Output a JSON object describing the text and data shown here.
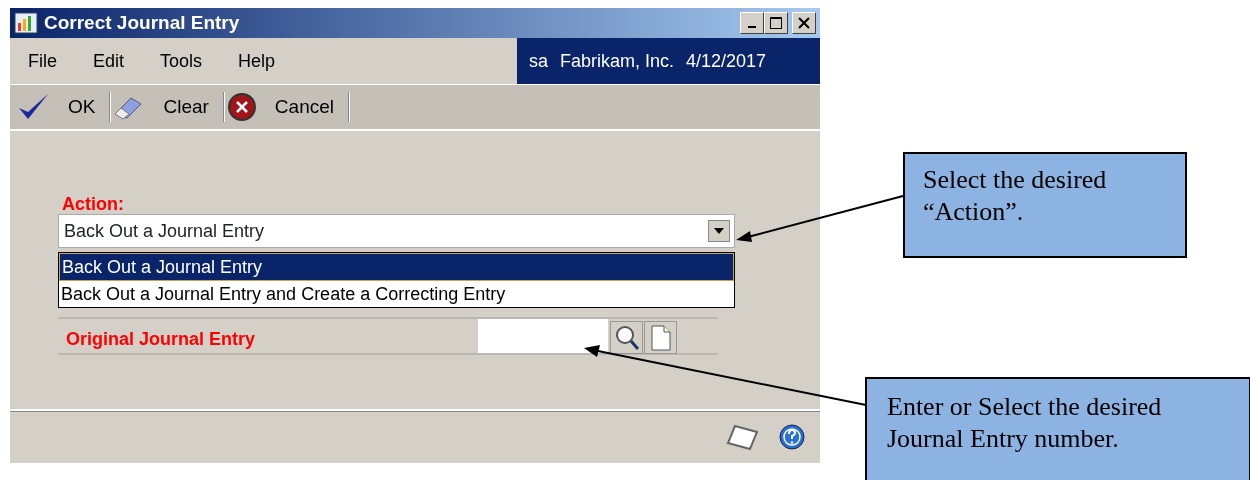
{
  "window": {
    "title": "Correct Journal Entry"
  },
  "menu": [
    {
      "label": "File"
    },
    {
      "label": "Edit"
    },
    {
      "label": "Tools"
    },
    {
      "label": "Help"
    }
  ],
  "session": {
    "user": "sa",
    "company": "Fabrikam, Inc.",
    "date": "4/12/2017"
  },
  "toolbar": [
    {
      "kind": "ok",
      "label": "OK"
    },
    {
      "kind": "clear",
      "label": "Clear"
    },
    {
      "kind": "cancel",
      "label": "Cancel"
    }
  ],
  "form": {
    "action_label": "Action:",
    "action_value": "Back Out a Journal Entry",
    "action_options": [
      {
        "label": "Back Out a Journal Entry",
        "selected": true
      },
      {
        "label": "Back Out a Journal Entry and Create a Correcting Entry",
        "selected": false
      }
    ],
    "entry_label": "Original Journal Entry"
  },
  "callouts": [
    {
      "text": "Select the desired “Action”."
    },
    {
      "text": "Enter or Select the desired Journal Entry number."
    }
  ]
}
